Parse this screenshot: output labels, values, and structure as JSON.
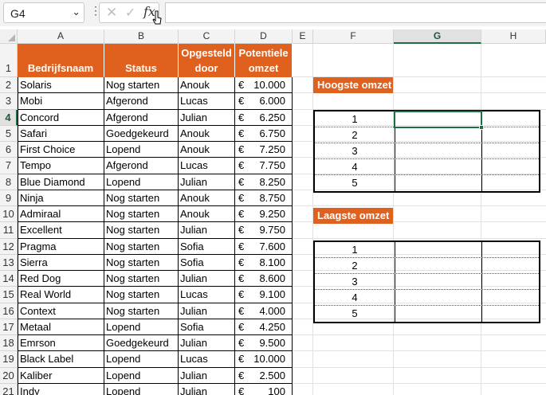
{
  "formula_bar": {
    "name_box": "G4",
    "formula": ""
  },
  "columns": [
    "A",
    "B",
    "C",
    "D",
    "E",
    "F",
    "G",
    "H"
  ],
  "rows": [
    "1",
    "2",
    "3",
    "4",
    "5",
    "6",
    "7",
    "8",
    "9",
    "10",
    "11",
    "12",
    "13",
    "14",
    "15",
    "16",
    "17",
    "18",
    "19",
    "20",
    "21"
  ],
  "table": {
    "headers": {
      "a": "Bedrijfsnaam",
      "b": "Status",
      "c1": "Opgesteld",
      "c2": "door",
      "d1": "Potentiele",
      "d2": "omzet"
    },
    "currency": "€",
    "records": [
      [
        "Solaris",
        "Nog starten",
        "Anouk",
        "10.000"
      ],
      [
        "Mobi",
        "Afgerond",
        "Lucas",
        "6.000"
      ],
      [
        "Concord",
        "Afgerond",
        "Julian",
        "6.250"
      ],
      [
        "Safari",
        "Goedgekeurd",
        "Anouk",
        "6.750"
      ],
      [
        "First Choice",
        "Lopend",
        "Anouk",
        "7.250"
      ],
      [
        "Tempo",
        "Afgerond",
        "Lucas",
        "7.750"
      ],
      [
        "Blue Diamond",
        "Lopend",
        "Julian",
        "8.250"
      ],
      [
        "Ninja",
        "Nog starten",
        "Anouk",
        "8.750"
      ],
      [
        "Admiraal",
        "Nog starten",
        "Anouk",
        "9.250"
      ],
      [
        "Excellent",
        "Nog starten",
        "Julian",
        "9.750"
      ],
      [
        "Pragma",
        "Nog starten",
        "Sofia",
        "7.600"
      ],
      [
        "Sierra",
        "Nog starten",
        "Sofia",
        "8.100"
      ],
      [
        "Red Dog",
        "Nog starten",
        "Julian",
        "8.600"
      ],
      [
        "Real World",
        "Nog starten",
        "Lucas",
        "9.100"
      ],
      [
        "Context",
        "Nog starten",
        "Julian",
        "4.000"
      ],
      [
        "Metaal",
        "Lopend",
        "Sofia",
        "4.250"
      ],
      [
        "Emrson",
        "Goedgekeurd",
        "Julian",
        "9.500"
      ],
      [
        "Black Label",
        "Lopend",
        "Lucas",
        "10.000"
      ],
      [
        "Kaliber",
        "Lopend",
        "Julian",
        "2.500"
      ],
      [
        "Indy",
        "Lopend",
        "Julian",
        "100"
      ]
    ]
  },
  "hoogste": {
    "label": "Hoogste omzet",
    "ranks": [
      "1",
      "2",
      "3",
      "4",
      "5"
    ]
  },
  "laagste": {
    "label": "Laagste omzet",
    "ranks": [
      "1",
      "2",
      "3",
      "4",
      "5"
    ]
  },
  "colors": {
    "accent": "#e0611d",
    "selection": "#1e6e42"
  }
}
